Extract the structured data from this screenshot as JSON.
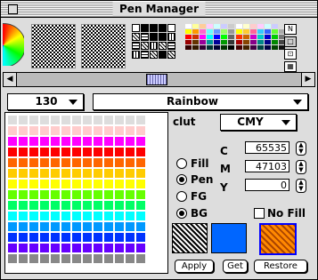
{
  "window": {
    "title": "Pen Manager"
  },
  "toolbar": {
    "pattern_label": "N",
    "mode_buttons": [
      "N",
      "□",
      "⊡",
      "▦",
      "▪"
    ]
  },
  "popups": {
    "index": "130",
    "palette": "Rainbow",
    "model": "CMY"
  },
  "palette_label": "clut",
  "fields": {
    "c": {
      "label": "C",
      "value": "65535"
    },
    "m": {
      "label": "M",
      "value": "47103"
    },
    "y": {
      "label": "Y",
      "value": "0"
    }
  },
  "targets": [
    {
      "label": "Fill",
      "selected": false
    },
    {
      "label": "Pen",
      "selected": true
    },
    {
      "label": "FG",
      "selected": false
    },
    {
      "label": "BG",
      "selected": true
    }
  ],
  "no_fill": {
    "label": "No Fill",
    "checked": false
  },
  "buttons": {
    "apply": "Apply",
    "get": "Get",
    "restore": "Restore"
  },
  "colors": {
    "pen": "#0066ff",
    "palette_rows": [
      [
        "#dddddd",
        "#dddddd",
        "#dddddd",
        "#dddddd",
        "#dddddd",
        "#dddddd",
        "#dddddd",
        "#dddddd",
        "#dddddd",
        "#dddddd",
        "#dddddd",
        "#dddddd",
        "#dddddd"
      ],
      [
        "#ffcccc",
        "#ffcccc",
        "#ffcccc",
        "#ffcccc",
        "#ffcccc",
        "#ffcccc",
        "#ffcccc",
        "#ffcccc",
        "#ffcccc",
        "#ffcccc",
        "#ffcccc",
        "#ffcccc",
        "#ffcccc"
      ],
      [
        "#ff00ff",
        "#ff00ff",
        "#ff00ff",
        "#ff00ff",
        "#ff00ff",
        "#ff00ff",
        "#ff00ff",
        "#ff00ff",
        "#ff00ff",
        "#ff00ff",
        "#ff00ff",
        "#ff00ff",
        "#ff00ff"
      ],
      [
        "#ff0000",
        "#ff0000",
        "#ff0000",
        "#ff0000",
        "#ff0000",
        "#ff0000",
        "#ff0000",
        "#ff0000",
        "#ff0000",
        "#ff0000",
        "#ff0000",
        "#ff0000",
        "#ff0000"
      ],
      [
        "#ff6600",
        "#ff6600",
        "#ff6600",
        "#ff6600",
        "#ff6600",
        "#ff6600",
        "#ff6600",
        "#ff6600",
        "#ff6600",
        "#ff6600",
        "#ff6600",
        "#ff6600",
        "#ff6600"
      ],
      [
        "#ffcc00",
        "#ffcc00",
        "#ffcc00",
        "#ffcc00",
        "#ffcc00",
        "#ffcc00",
        "#ffcc00",
        "#ffcc00",
        "#ffcc00",
        "#ffcc00",
        "#ffcc00",
        "#ffcc00",
        "#ffcc00"
      ],
      [
        "#ffff00",
        "#ffff00",
        "#ffff00",
        "#ffff00",
        "#ffff00",
        "#ffff00",
        "#ffff00",
        "#ffff00",
        "#ffff00",
        "#ffff00",
        "#ffff00",
        "#ffff00",
        "#ffff00"
      ],
      [
        "#66ff00",
        "#66ff00",
        "#66ff00",
        "#66ff00",
        "#66ff00",
        "#66ff00",
        "#66ff00",
        "#66ff00",
        "#66ff00",
        "#66ff00",
        "#66ff00",
        "#66ff00",
        "#66ff00"
      ],
      [
        "#00ff66",
        "#00ff66",
        "#00ff66",
        "#00ff66",
        "#00ff66",
        "#00ff66",
        "#00ff66",
        "#00ff66",
        "#00ff66",
        "#00ff66",
        "#00ff66",
        "#00ff66",
        "#00ff66"
      ],
      [
        "#00ffff",
        "#00ffff",
        "#00ffff",
        "#00ffff",
        "#00ffff",
        "#00ffff",
        "#00ffff",
        "#00ffff",
        "#00ffff",
        "#00ffff",
        "#00ffff",
        "#00ffff",
        "#00ffff"
      ],
      [
        "#0099ff",
        "#0099ff",
        "#0099ff",
        "#0099ff",
        "#0099ff",
        "#0099ff",
        "#0099ff",
        "#0099ff",
        "#0099ff",
        "#0099ff",
        "#0099ff",
        "#0099ff",
        "#0099ff"
      ],
      [
        "#0033ff",
        "#0033ff",
        "#0033ff",
        "#0033ff",
        "#0033ff",
        "#0033ff",
        "#0033ff",
        "#0033ff",
        "#0033ff",
        "#0033ff",
        "#0033ff",
        "#0033ff",
        "#0033ff"
      ],
      [
        "#6600ff",
        "#6600ff",
        "#6600ff",
        "#6600ff",
        "#6600ff",
        "#6600ff",
        "#6600ff",
        "#6600ff",
        "#6600ff",
        "#6600ff",
        "#6600ff",
        "#6600ff",
        "#6600ff"
      ],
      [
        "#888888",
        "#888888",
        "#888888",
        "#888888",
        "#888888",
        "#888888",
        "#888888",
        "#888888",
        "#888888",
        "#888888",
        "#888888",
        "#888888",
        "#888888"
      ]
    ]
  }
}
